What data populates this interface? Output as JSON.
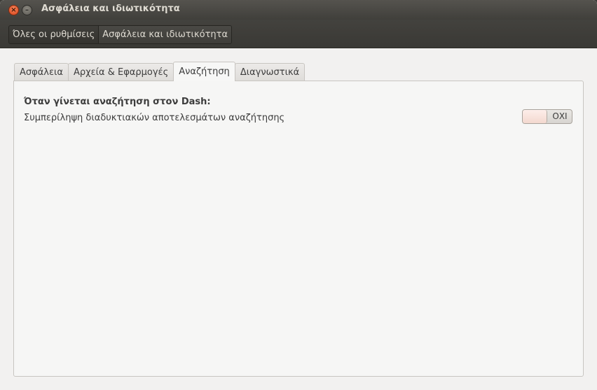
{
  "window": {
    "title": "Ασφάλεια και ιδιωτικότητα",
    "close_symbol": "×",
    "minimize_symbol": "–"
  },
  "toolbar": {
    "breadcrumbs": [
      {
        "label": "Όλες οι ρυθμίσεις"
      },
      {
        "label": "Ασφάλεια και ιδιωτικότητα"
      }
    ]
  },
  "tabs": [
    {
      "label": "Ασφάλεια"
    },
    {
      "label": "Αρχεία & Εφαρμογές"
    },
    {
      "label": "Αναζήτηση",
      "selected": true
    },
    {
      "label": "Διαγνωστικά"
    }
  ],
  "search_panel": {
    "heading": "Όταν γίνεται αναζήτηση στον Dash:",
    "option_label": "Συμπερίληψη διαδυκτιακών αποτελεσμάτων αναζήτησης",
    "toggle": {
      "state_text": "ΟΧΙ",
      "on": false
    }
  },
  "colors": {
    "titlebar": "#403f3b",
    "close_button": "#d9461c",
    "window_bg": "#f2f1f0"
  }
}
